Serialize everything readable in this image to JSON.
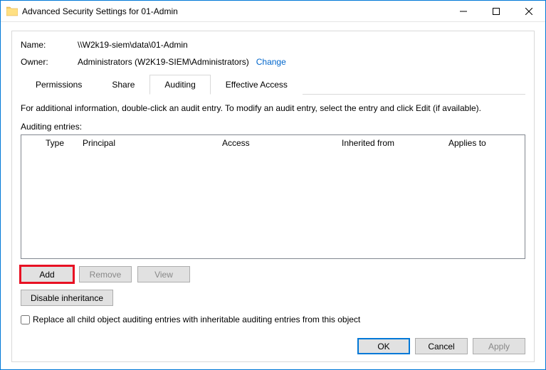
{
  "titlebar": {
    "title": "Advanced Security Settings for 01-Admin"
  },
  "info": {
    "name_label": "Name:",
    "name_value": "\\\\W2k19-siem\\data\\01-Admin",
    "owner_label": "Owner:",
    "owner_value": "Administrators (W2K19-SIEM\\Administrators)",
    "change_link": "Change"
  },
  "tabs": {
    "permissions": "Permissions",
    "share": "Share",
    "auditing": "Auditing",
    "effective_access": "Effective Access"
  },
  "auditing": {
    "help_text": "For additional information, double-click an audit entry. To modify an audit entry, select the entry and click Edit (if available).",
    "entries_label": "Auditing entries:",
    "columns": {
      "type": "Type",
      "principal": "Principal",
      "access": "Access",
      "inherited": "Inherited from",
      "applies": "Applies to"
    },
    "buttons": {
      "add": "Add",
      "remove": "Remove",
      "view": "View",
      "disable_inheritance": "Disable inheritance"
    },
    "checkbox_label": "Replace all child object auditing entries with inheritable auditing entries from this object"
  },
  "dialog": {
    "ok": "OK",
    "cancel": "Cancel",
    "apply": "Apply"
  }
}
